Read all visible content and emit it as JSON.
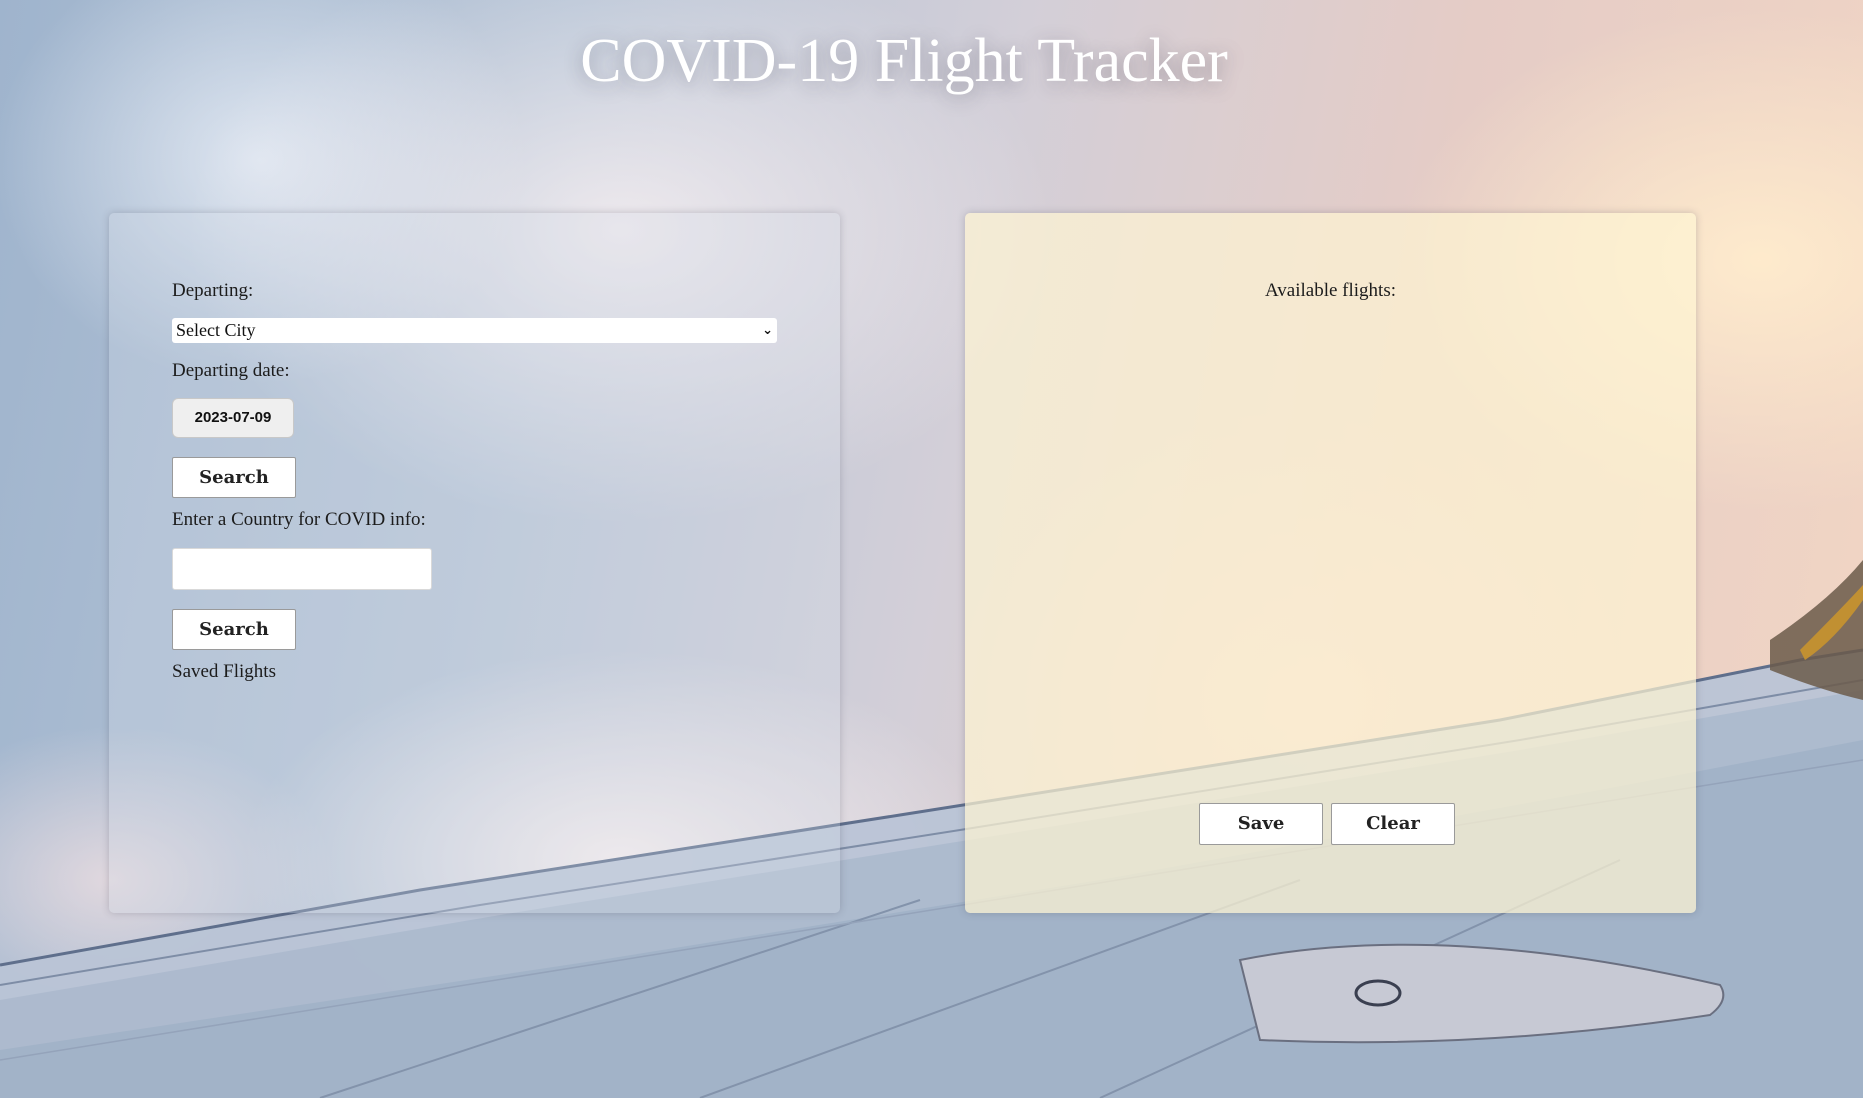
{
  "page": {
    "title": "COVID-19 Flight Tracker"
  },
  "search_panel": {
    "departing_label": "Departing:",
    "city_select_value": "Select City",
    "departing_date_label": "Departing date:",
    "departing_date_value": "2023-07-09",
    "search_button_label": "Search",
    "country_label": "Enter a Country for COVID info:",
    "country_input_value": "",
    "country_search_button_label": "Search",
    "saved_flights_label": "Saved Flights"
  },
  "results_panel": {
    "heading": "Available flights:",
    "save_button_label": "Save",
    "clear_button_label": "Clear"
  },
  "icons": {
    "city_select_arrow": "chevron-down-icon"
  }
}
